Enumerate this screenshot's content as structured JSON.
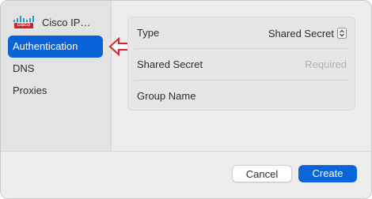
{
  "sidebar": {
    "title": "Cisco IP…",
    "logo_text": "CISCO",
    "items": [
      {
        "label": "Authentication",
        "selected": true
      },
      {
        "label": "DNS",
        "selected": false
      },
      {
        "label": "Proxies",
        "selected": false
      }
    ]
  },
  "form": {
    "type_label": "Type",
    "type_value": "Shared Secret",
    "shared_secret_label": "Shared Secret",
    "shared_secret_placeholder": "Required",
    "shared_secret_value": "",
    "group_name_label": "Group Name",
    "group_name_value": ""
  },
  "footer": {
    "cancel_label": "Cancel",
    "create_label": "Create"
  },
  "colors": {
    "accent": "#0a63d6",
    "annotation_arrow": "#d9262c"
  },
  "icons": {
    "logo": "cisco-logo-icon",
    "select": "up-down-chevron-icon",
    "annotation": "left-arrow-icon"
  }
}
